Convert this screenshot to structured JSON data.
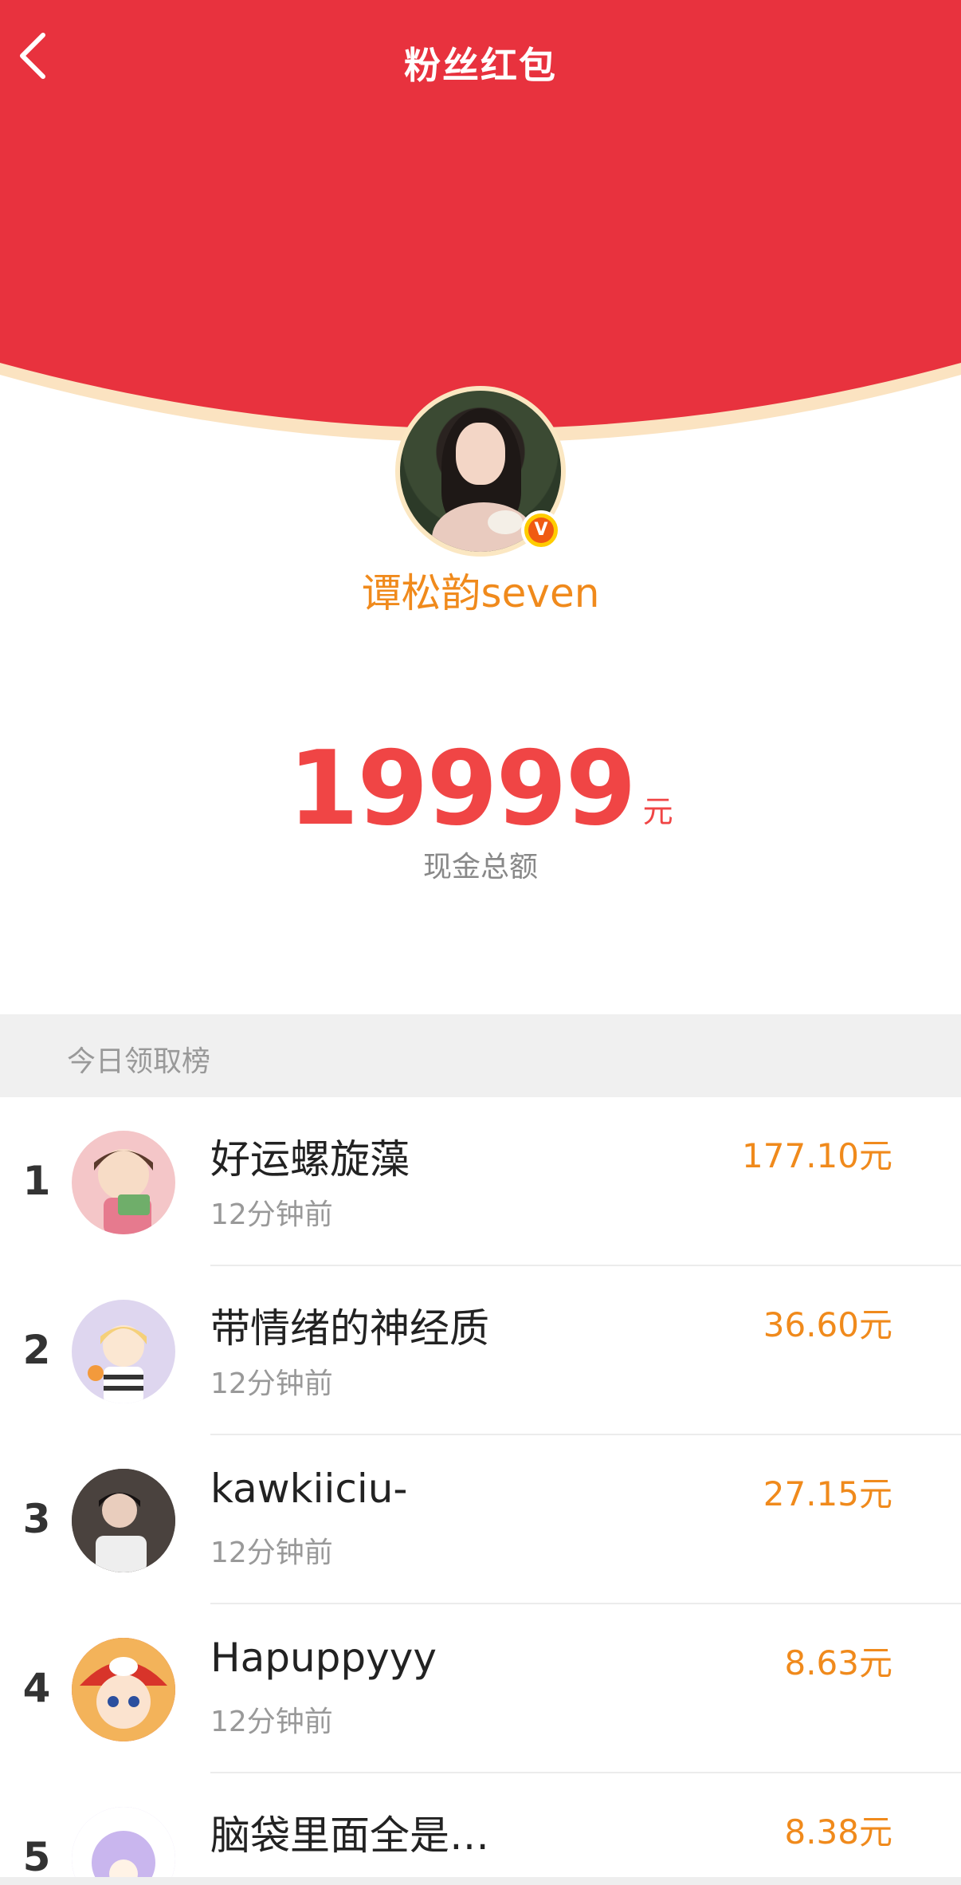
{
  "header": {
    "title": "粉丝红包",
    "colors": {
      "red": "#e8323e",
      "rim": "#fbe3c1"
    }
  },
  "profile": {
    "name": "谭松韵seven",
    "badge_letter": "V"
  },
  "summary": {
    "amount": "19999",
    "unit": "元",
    "label": "现金总额"
  },
  "leaderboard": {
    "title": "今日领取榜",
    "rows": [
      {
        "rank": "1",
        "name": "好运螺旋藻",
        "time": "12分钟前",
        "amount": "177.10元"
      },
      {
        "rank": "2",
        "name": "带情绪的神经质",
        "time": "12分钟前",
        "amount": "36.60元"
      },
      {
        "rank": "3",
        "name": "kawkiiciu-",
        "time": "12分钟前",
        "amount": "27.15元"
      },
      {
        "rank": "4",
        "name": "Hapuppyyy",
        "time": "12分钟前",
        "amount": "8.63元"
      },
      {
        "rank": "5",
        "name": "脑袋里面全是…",
        "time": "",
        "amount": "8.38元"
      }
    ]
  }
}
